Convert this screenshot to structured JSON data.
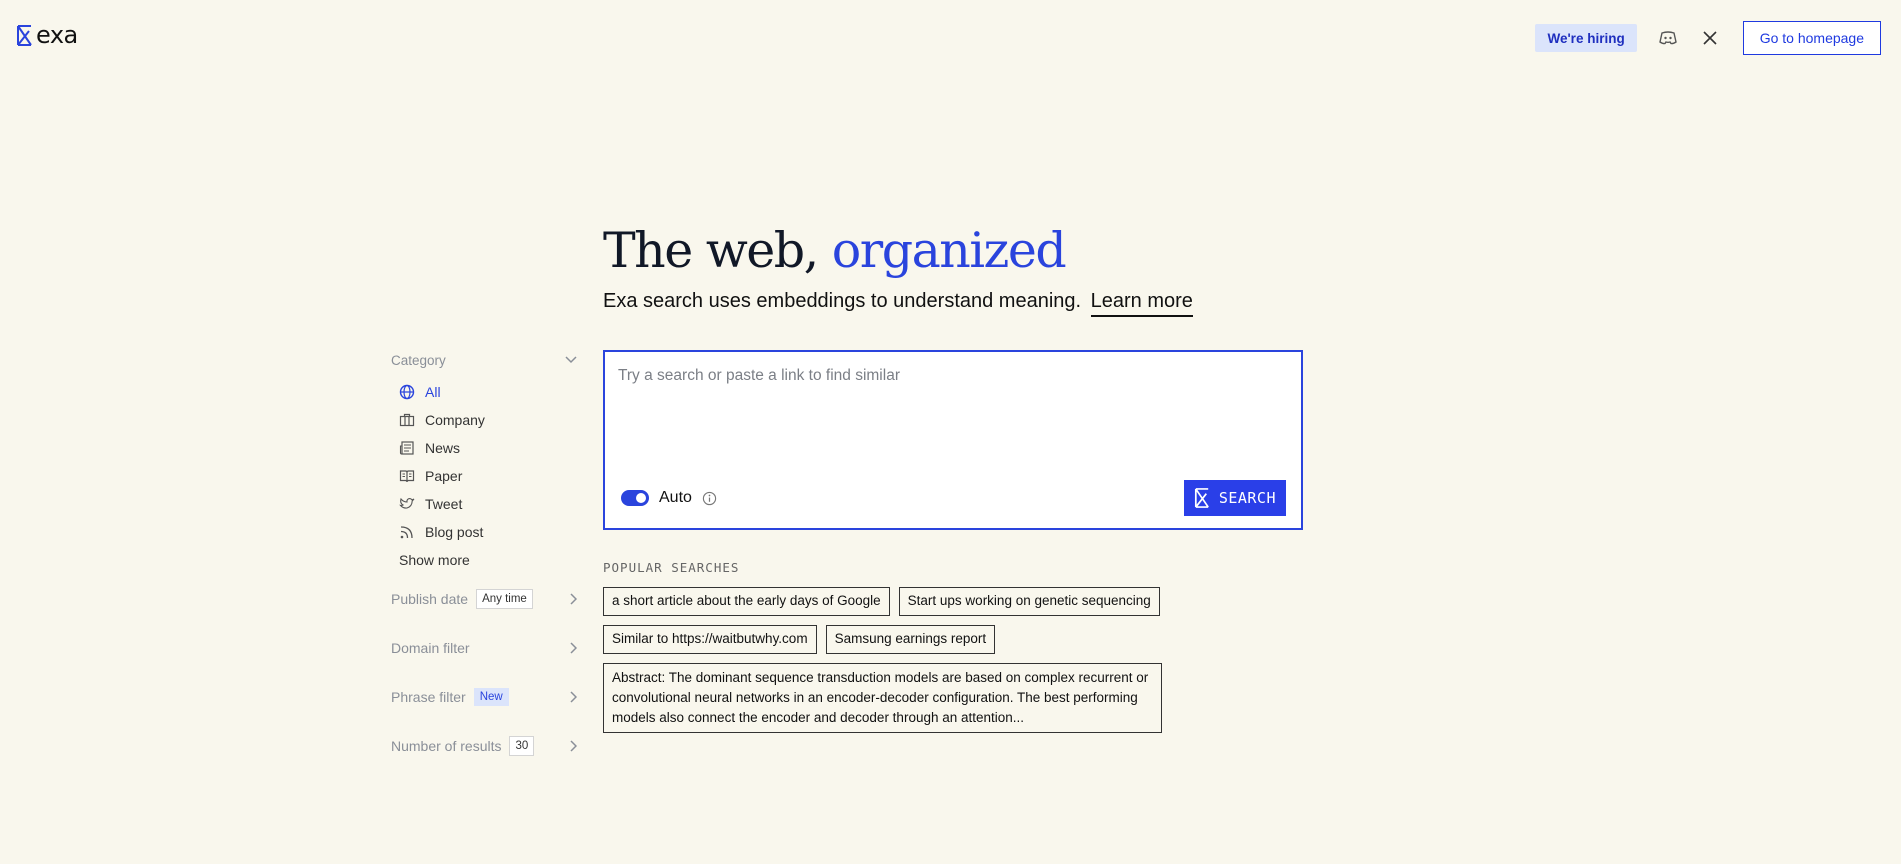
{
  "header": {
    "logo_text": "exa",
    "hiring_label": "We're hiring",
    "discord_icon": "discord-icon",
    "x_icon": "x-icon",
    "home_label": "Go to homepage"
  },
  "hero": {
    "title_plain": "The web, ",
    "title_accent": "organized",
    "subtitle": "Exa search uses embeddings to understand meaning.",
    "learn_more": "Learn more"
  },
  "sidebar": {
    "category_label": "Category",
    "categories": [
      {
        "label": "All",
        "icon": "globe-icon"
      },
      {
        "label": "Company",
        "icon": "briefcase-icon"
      },
      {
        "label": "News",
        "icon": "newspaper-icon"
      },
      {
        "label": "Paper",
        "icon": "book-icon"
      },
      {
        "label": "Tweet",
        "icon": "twitter-icon"
      },
      {
        "label": "Blog post",
        "icon": "rss-icon"
      }
    ],
    "show_more": "Show more",
    "filters": {
      "publish_date": {
        "label": "Publish date",
        "value": "Any time"
      },
      "domain_filter": {
        "label": "Domain filter"
      },
      "phrase_filter": {
        "label": "Phrase filter",
        "badge": "New"
      },
      "num_results": {
        "label": "Number of results",
        "value": "30"
      }
    }
  },
  "search": {
    "placeholder": "Try a search or paste a link to find similar",
    "value": "",
    "auto_label": "Auto",
    "button_label": "SEARCH"
  },
  "popular": {
    "title": "POPULAR SEARCHES",
    "items": [
      "a short article about the early days of Google",
      "Start ups working on genetic sequencing",
      "Similar to https://waitbutwhy.com",
      "Samsung earnings report",
      "Abstract: The dominant sequence transduction models are based on complex recurrent or convolutional neural networks in an encoder-decoder configuration. The best performing models also connect the encoder and decoder through an attention..."
    ]
  },
  "colors": {
    "background": "#f9f7ed",
    "accent": "#2a44dd"
  }
}
